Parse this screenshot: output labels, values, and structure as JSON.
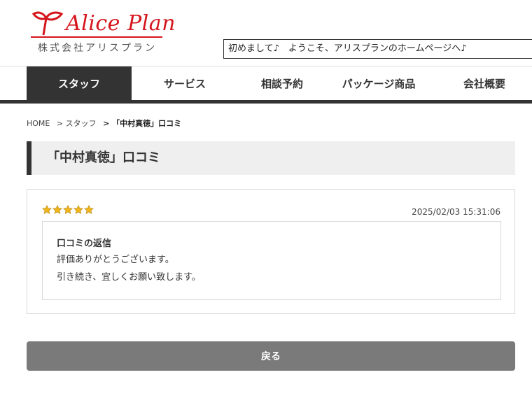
{
  "header": {
    "logo_text": "Alice Plan",
    "logo_sub": "株式会社アリスプラン",
    "marquee": "初めまして♪　ようこそ、アリスプランのホームページへ♪",
    "brand_color": "#d4151c"
  },
  "nav": {
    "items": [
      {
        "label": "スタッフ",
        "active": true
      },
      {
        "label": "サービス",
        "active": false
      },
      {
        "label": "相談予約",
        "active": false
      },
      {
        "label": "パッケージ商品",
        "active": false
      },
      {
        "label": "会社概要",
        "active": false
      }
    ]
  },
  "breadcrumb": {
    "home": "HOME",
    "staff": "> スタッフ",
    "current": "> 「中村真徳」口コミ"
  },
  "page": {
    "title": "「中村真徳」口コミ"
  },
  "review": {
    "rating": 5,
    "rating_max": 5,
    "date": "2025/02/03 15:31:06",
    "reply_title": "口コミの返信",
    "reply_lines": [
      "評価ありがとうございます。",
      "引き続き、宜しくお願い致します。"
    ]
  },
  "actions": {
    "back_label": "戻る"
  }
}
